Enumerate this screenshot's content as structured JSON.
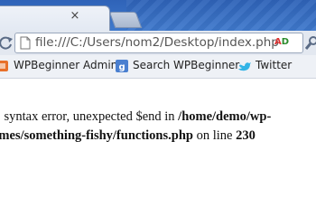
{
  "tab": {
    "title": "",
    "close_glyph": "×"
  },
  "omnibox": {
    "url": "file:///C:/Users/nom2/Desktop/index.php",
    "extension_label_a": "A",
    "extension_label_d": "D",
    "extension_icon": "adblock-icon"
  },
  "bookmarks": [
    {
      "label": "WPBeginner Admin",
      "icon": "wpbeginner-favicon"
    },
    {
      "label": "Search WPBeginner",
      "icon": "google-search-favicon"
    },
    {
      "label": "Twitter",
      "icon": "twitter-bird-icon"
    }
  ],
  "error": {
    "line1_prefix": "r: syntax error, unexpected $end in ",
    "line1_path": "/home/demo/wp-",
    "line2_path": "emes/something-fishy/functions.php",
    "line2_mid": " on line ",
    "line2_number": "230"
  },
  "colors": {
    "tabstrip": "#3a72c4",
    "toolbar": "#e3e8f0",
    "bookmarks_bar": "#eef1f6",
    "twitter": "#33b4e6",
    "search_icon": "#4a7fd0",
    "wpbeginner_icon": "#e8702a"
  }
}
